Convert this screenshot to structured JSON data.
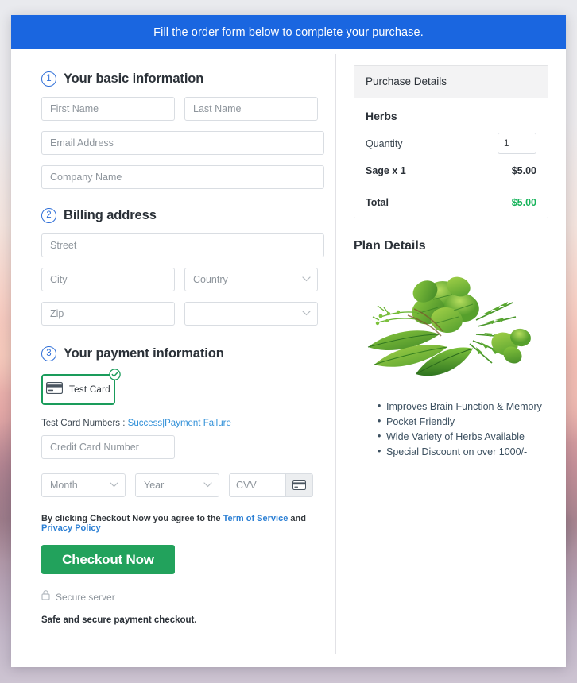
{
  "banner": {
    "text": "Fill the order form below to complete your purchase."
  },
  "sections": {
    "basic": {
      "step": "1",
      "title": "Your basic information",
      "first_name_placeholder": "First Name",
      "last_name_placeholder": "Last Name",
      "email_placeholder": "Email Address",
      "company_placeholder": "Company Name"
    },
    "billing": {
      "step": "2",
      "title": "Billing address",
      "street_placeholder": "Street",
      "city_placeholder": "City",
      "country_selected": "Country",
      "zip_placeholder": "Zip",
      "state_selected": "-"
    },
    "payment": {
      "step": "3",
      "title": "Your payment information",
      "test_card_label": "Test Card",
      "test_card_selected": true,
      "card_numbers_prefix": "Test Card Numbers :",
      "card_numbers_success": "Success",
      "card_numbers_separator": "|",
      "card_numbers_failure": "Payment Failure",
      "credit_card_placeholder": "Credit Card Number",
      "month_selected": "Month",
      "year_selected": "Year",
      "cvv_placeholder": "CVV",
      "terms_prefix": "By clicking Checkout Now you agree to the",
      "terms_of_service": "Term of Service",
      "terms_and": "and",
      "privacy_policy": "Privacy Policy",
      "checkout_label": "Checkout Now",
      "secure_server": "Secure server",
      "safe_note": "Safe and secure payment checkout."
    }
  },
  "purchase": {
    "header": "Purchase Details",
    "product": "Herbs",
    "quantity_label": "Quantity",
    "quantity_value": "1",
    "line_item_label": "Sage x 1",
    "line_item_amount": "$5.00",
    "total_label": "Total",
    "total_amount": "$5.00"
  },
  "plan": {
    "title": "Plan Details",
    "image_alt": "herbs-bundle-image",
    "bullets": [
      "Improves Brain Function & Memory",
      "Pocket Friendly",
      "Wide Variety of Herbs Available",
      "Special Discount on over 1000/-"
    ]
  },
  "colors": {
    "banner_blue": "#1a66e0",
    "step_blue": "#2f6fd8",
    "checkout_green": "#22a25c",
    "total_green": "#16b35a",
    "link_blue": "#2b7fd4",
    "card_select_green": "#1a9c5b"
  }
}
